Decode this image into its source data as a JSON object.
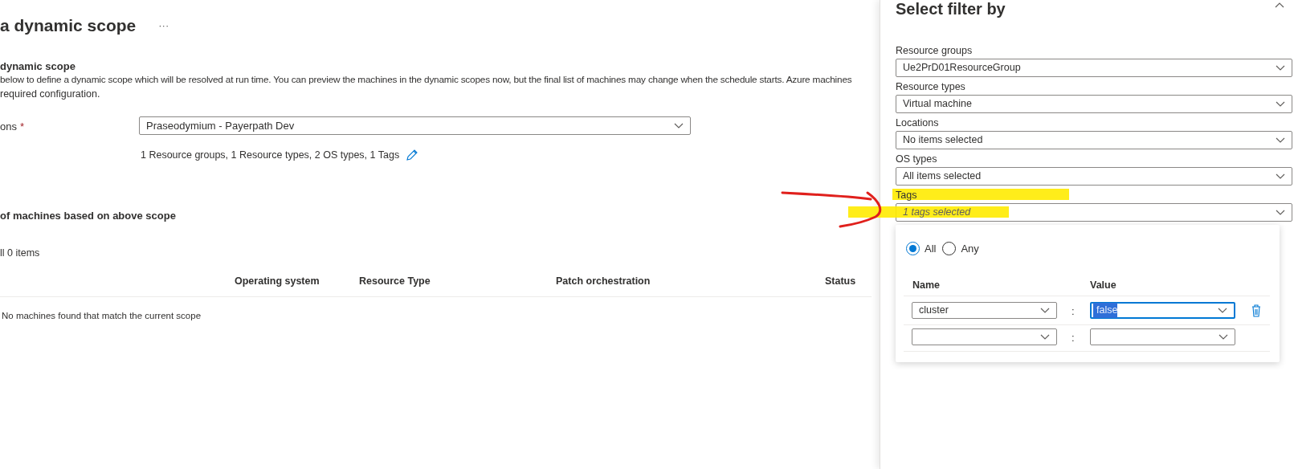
{
  "page": {
    "title": "a dynamic scope",
    "more": "···"
  },
  "scope_section": {
    "heading": "dynamic scope",
    "description": "below to define a dynamic scope which will be resolved at run time. You can preview the machines in the dynamic scopes now, but the final list of machines may change when the schedule starts. Azure machines",
    "description_2": "required configuration.",
    "field_label": "ons",
    "required_mark": "*",
    "subscription": "Praseodymium - Payerpath Dev",
    "filter_summary": "1 Resource groups, 1 Resource types, 2 OS types, 1 Tags"
  },
  "machines": {
    "heading": "of machines based on above scope",
    "count": "ll 0 items",
    "columns": [
      "Operating system",
      "Resource Type",
      "Patch orchestration",
      "Status"
    ],
    "empty_message": "No machines found that match the current scope"
  },
  "panel": {
    "title": "Select filter by",
    "filters": [
      {
        "label": "Resource groups",
        "value": "Ue2PrD01ResourceGroup",
        "italic": false
      },
      {
        "label": "Resource types",
        "value": "Virtual machine",
        "italic": false
      },
      {
        "label": "Locations",
        "value": "No items selected",
        "italic": false
      },
      {
        "label": "OS types",
        "value": "All items selected",
        "italic": false
      },
      {
        "label": "Tags",
        "value": "1 tags selected",
        "italic": true
      }
    ],
    "match_options": [
      {
        "label": "All",
        "selected": true
      },
      {
        "label": "Any",
        "selected": false
      }
    ],
    "tag_columns": [
      "Name",
      "Value"
    ],
    "tag_rows": [
      {
        "name": "cluster",
        "separator": ":",
        "value": "false",
        "focused": true,
        "deletable": true
      },
      {
        "name": "",
        "separator": ":",
        "value": "",
        "focused": false,
        "deletable": false
      }
    ]
  }
}
